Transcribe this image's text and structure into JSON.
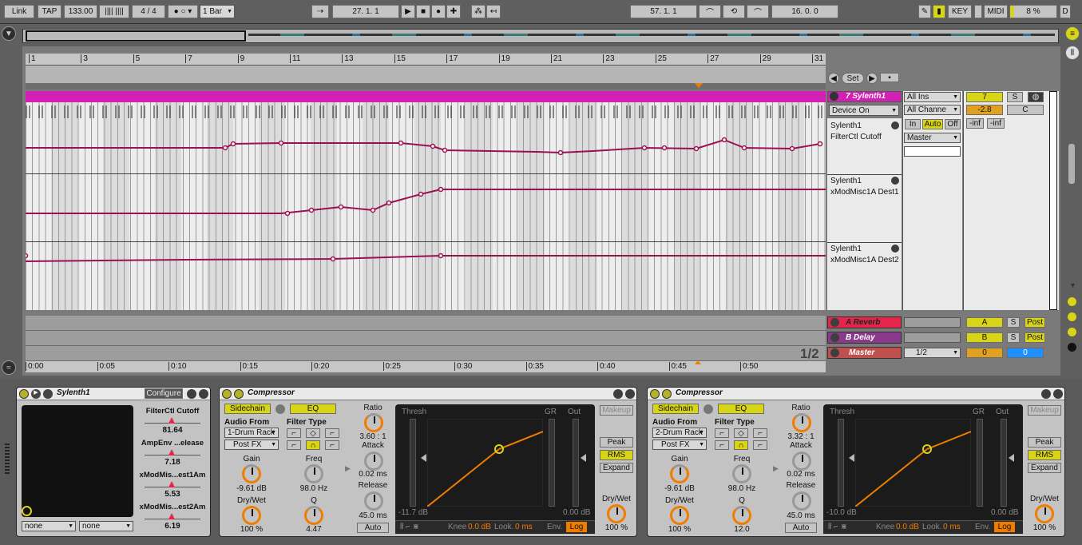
{
  "transport": {
    "link": "Link",
    "tap": "TAP",
    "tempo": "133.00",
    "sig": "4 / 4",
    "quant": "1 Bar",
    "pos": "27.  1.  1",
    "loop_start": "57.  1.  1",
    "loop_len": "16.  0.  0",
    "key": "KEY",
    "midi": "MIDI",
    "cpu": "8 %",
    "d": "D"
  },
  "ruler": {
    "bars": [
      "1",
      "3",
      "5",
      "7",
      "9",
      "11",
      "13",
      "15",
      "17",
      "19",
      "21",
      "23",
      "25",
      "27",
      "29",
      "31"
    ],
    "times": [
      "0:00",
      "0:05",
      "0:10",
      "0:15",
      "0:20",
      "0:25",
      "0:30",
      "0:35",
      "0:40",
      "0:45",
      "0:50"
    ],
    "page": "1/2"
  },
  "track": {
    "name": "7 Sylenth1",
    "device_sel": "Device On",
    "lanes": [
      {
        "dev": "Sylenth1",
        "param": "FilterCtl Cutoff"
      },
      {
        "dev": "Sylenth1",
        "param": "xModMisc1A Dest1"
      },
      {
        "dev": "Sylenth1",
        "param": "xModMisc1A Dest2"
      }
    ],
    "input_type": "All Ins",
    "input_chan": "All Channe",
    "mon_in": "In",
    "mon_auto": "Auto",
    "mon_off": "Off",
    "output": "Master",
    "num": "7",
    "solo": "S",
    "vol": "-2.8",
    "pan": "C",
    "inf1": "-inf",
    "inf2": "-inf",
    "set": "Set"
  },
  "returns": [
    {
      "name": "A Reverb",
      "letter": "A",
      "s": "S",
      "post": "Post"
    },
    {
      "name": "B Delay",
      "letter": "B",
      "s": "S",
      "post": "Post"
    }
  ],
  "master": {
    "name": "Master",
    "out": "1/2",
    "v1": "0",
    "v2": "0"
  },
  "synth": {
    "title": "Sylenth1",
    "configure": "Configure",
    "params": [
      {
        "name": "FilterCtl Cutoff",
        "value": "81.64"
      },
      {
        "name": "AmpEnv ...elease",
        "value": "7.18"
      },
      {
        "name": "xModMis...est1Am",
        "value": "5.53"
      },
      {
        "name": "xModMis...est2Am",
        "value": "6.19"
      }
    ],
    "sel1": "none",
    "sel2": "none"
  },
  "comps": [
    {
      "title": "Compressor",
      "sidechain": "Sidechain",
      "eq": "EQ",
      "audio_from": "Audio From",
      "src": "1-Drum Rack",
      "post": "Post FX",
      "gain_l": "Gain",
      "gain": "-9.61 dB",
      "drywet_l": "Dry/Wet",
      "drywet": "100 %",
      "ftype": "Filter Type",
      "freq_l": "Freq",
      "freq": "98.0 Hz",
      "q_l": "Q",
      "q": "4.47",
      "ratio_l": "Ratio",
      "ratio": "3.60 : 1",
      "attack_l": "Attack",
      "attack": "0.02 ms",
      "release_l": "Release",
      "release": "45.0 ms",
      "auto": "Auto",
      "thresh": "Thresh",
      "gr": "GR",
      "out": "Out",
      "thr_val": "-11.7 dB",
      "out_val": "0.00 dB",
      "knee_l": "Knee",
      "knee": "0.0 dB",
      "look_l": "Look.",
      "look": "0 ms",
      "env_l": "Env.",
      "env": "Log",
      "makeup": "Makeup",
      "peak": "Peak",
      "rms": "RMS",
      "expand": "Expand",
      "dw2_l": "Dry/Wet",
      "dw2": "100 %"
    },
    {
      "title": "Compressor",
      "sidechain": "Sidechain",
      "eq": "EQ",
      "audio_from": "Audio From",
      "src": "2-Drum Rack",
      "post": "Post FX",
      "gain_l": "Gain",
      "gain": "-9.61 dB",
      "drywet_l": "Dry/Wet",
      "drywet": "100 %",
      "ftype": "Filter Type",
      "freq_l": "Freq",
      "freq": "98.0 Hz",
      "q_l": "Q",
      "q": "12.0",
      "ratio_l": "Ratio",
      "ratio": "3.32 : 1",
      "attack_l": "Attack",
      "attack": "0.02 ms",
      "release_l": "Release",
      "release": "45.0 ms",
      "auto": "Auto",
      "thresh": "Thresh",
      "gr": "GR",
      "out": "Out",
      "thr_val": "-10.0 dB",
      "out_val": "0.00 dB",
      "knee_l": "Knee",
      "knee": "0.0 dB",
      "look_l": "Look.",
      "look": "0 ms",
      "env_l": "Env.",
      "env": "Log",
      "makeup": "Makeup",
      "peak": "Peak",
      "rms": "RMS",
      "expand": "Expand",
      "dw2_l": "Dry/Wet",
      "dw2": "100 %"
    }
  ],
  "colors": {
    "track": "#d41fb4",
    "reverb": "#e5264a",
    "delay": "#8a3a8a",
    "master": "#c0504d",
    "automation": "#9a1050",
    "accent": "#f07d00",
    "yellow": "#d8d416"
  }
}
